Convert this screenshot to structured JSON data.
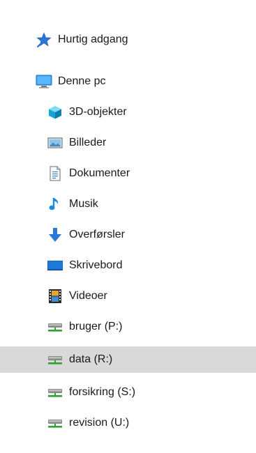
{
  "nav": {
    "quick_access": {
      "label": "Hurtig adgang",
      "icon": "pin-star-icon",
      "accent": "#2b73d6"
    },
    "this_pc": {
      "label": "Denne pc",
      "icon": "monitor-icon",
      "accent": "#1e88e5"
    },
    "folders": [
      {
        "label": "3D-objekter",
        "icon": "cube-3d-icon"
      },
      {
        "label": "Billeder",
        "icon": "pictures-icon"
      },
      {
        "label": "Dokumenter",
        "icon": "documents-icon"
      },
      {
        "label": "Musik",
        "icon": "music-note-icon"
      },
      {
        "label": "Overførsler",
        "icon": "download-arrow-icon"
      },
      {
        "label": "Skrivebord",
        "icon": "desktop-icon"
      },
      {
        "label": "Videoer",
        "icon": "film-icon"
      }
    ],
    "drives": [
      {
        "label": "bruger (P:)",
        "icon": "network-drive-icon"
      },
      {
        "label": "data (R:)",
        "icon": "network-drive-icon",
        "selected": true
      },
      {
        "label": "forsikring (S:)",
        "icon": "network-drive-icon"
      },
      {
        "label": "revision (U:)",
        "icon": "network-drive-icon"
      }
    ],
    "selection_color": "#d9d9d9"
  }
}
